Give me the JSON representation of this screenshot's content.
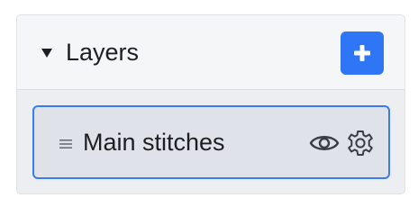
{
  "panel": {
    "title": "Layers",
    "collapse_icon": "caret-down-icon",
    "add_icon": "plus-icon",
    "accent_color": "#2f76f6"
  },
  "layers": [
    {
      "name": "Main stitches",
      "selected": true,
      "icons": [
        "drag-handle-icon",
        "eye-icon",
        "gear-icon"
      ]
    }
  ]
}
